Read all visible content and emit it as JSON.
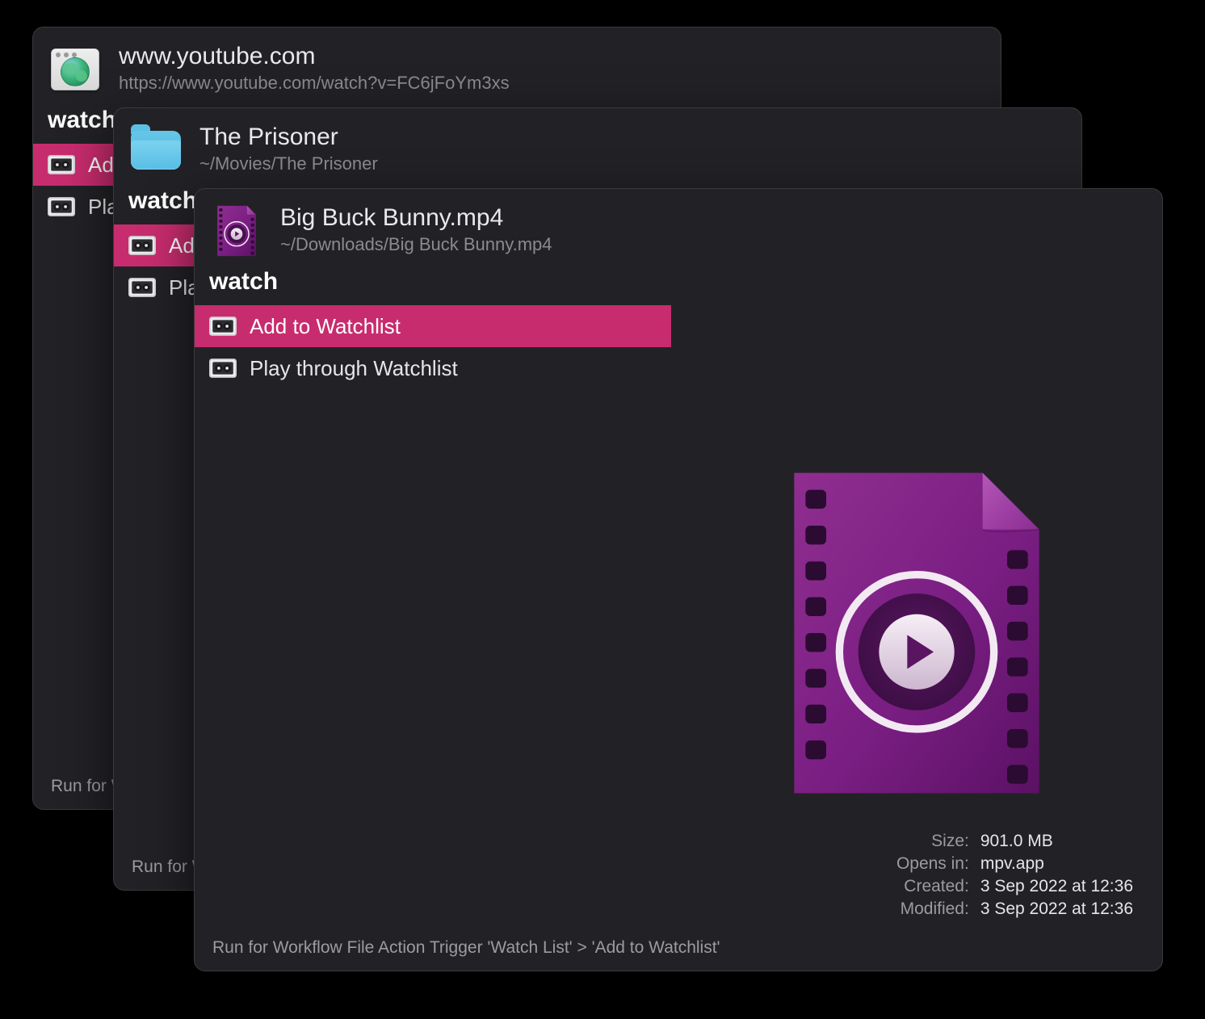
{
  "panels": {
    "back": {
      "header": {
        "title": "www.youtube.com",
        "subtitle": "https://www.youtube.com/watch?v=FC6jFoYm3xs"
      },
      "query": "watch",
      "results": [
        {
          "label": "Add to Watchlist",
          "selected": true
        },
        {
          "label": "Play through Watchlist",
          "selected": false
        }
      ],
      "footer": "Run for Workflow File Action Trigger 'Watch List' > 'Add to Watchlist'"
    },
    "mid": {
      "header": {
        "title": "The Prisoner",
        "subtitle": "~/Movies/The Prisoner"
      },
      "query": "watch",
      "results": [
        {
          "label": "Add to Watchlist",
          "selected": true
        },
        {
          "label": "Play through Watchlist",
          "selected": false
        }
      ],
      "footer": "Run for Workflow File Action Trigger 'Watch List' > 'Add to Watchlist'"
    },
    "front": {
      "header": {
        "title": "Big Buck Bunny.mp4",
        "subtitle": "~/Downloads/Big Buck Bunny.mp4"
      },
      "query": "watch",
      "results": [
        {
          "label": "Add to Watchlist",
          "selected": true
        },
        {
          "label": "Play through Watchlist",
          "selected": false
        }
      ],
      "footer": "Run for Workflow File Action Trigger 'Watch List' > 'Add to Watchlist'",
      "preview": {
        "size": {
          "label": "Size:",
          "value": "901.0 MB"
        },
        "opens_in": {
          "label": "Opens in:",
          "value": "mpv.app"
        },
        "created": {
          "label": "Created:",
          "value": "3 Sep 2022 at 12:36"
        },
        "modified": {
          "label": "Modified:",
          "value": "3 Sep 2022 at 12:36"
        }
      }
    }
  }
}
